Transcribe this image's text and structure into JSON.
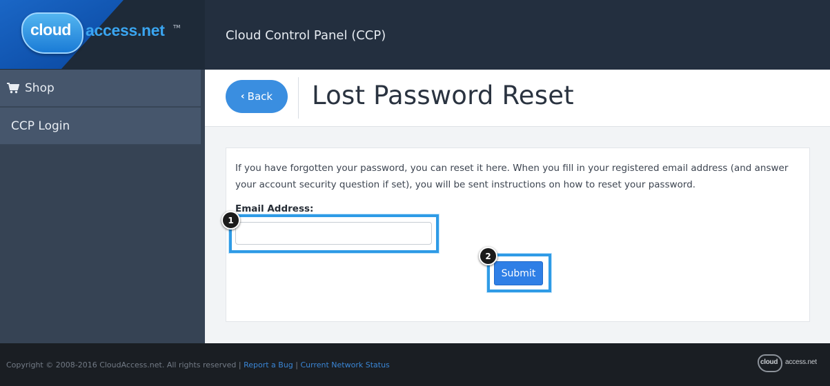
{
  "brand": {
    "logo_cloud": "cloud",
    "logo_access": "access.net",
    "logo_tm": "TM",
    "accent_color": "#3a8ee0"
  },
  "header": {
    "title": "Cloud Control Panel (CCP)"
  },
  "sidebar": {
    "items": [
      {
        "label": "Shop",
        "icon": "shopping-cart-icon"
      },
      {
        "label": "CCP Login"
      }
    ]
  },
  "main": {
    "back_label": "Back",
    "page_title": "Lost Password Reset",
    "intro_text": "If you have forgotten your password, you can reset it here. When you fill in your registered email address (and answer your account security question if set), you will be sent instructions on how to reset your password.",
    "email_label": "Email Address:",
    "email_value": "",
    "email_placeholder": "",
    "submit_label": "Submit",
    "annotations": [
      "1",
      "2"
    ]
  },
  "footer": {
    "copyright": "Copyright © 2008-2016 CloudAccess.net. All rights reserved",
    "separator": "|",
    "report_bug": "Report a Bug",
    "network_status": "Current Network Status",
    "logo_cloud": "cloud",
    "logo_access": "access.net"
  }
}
